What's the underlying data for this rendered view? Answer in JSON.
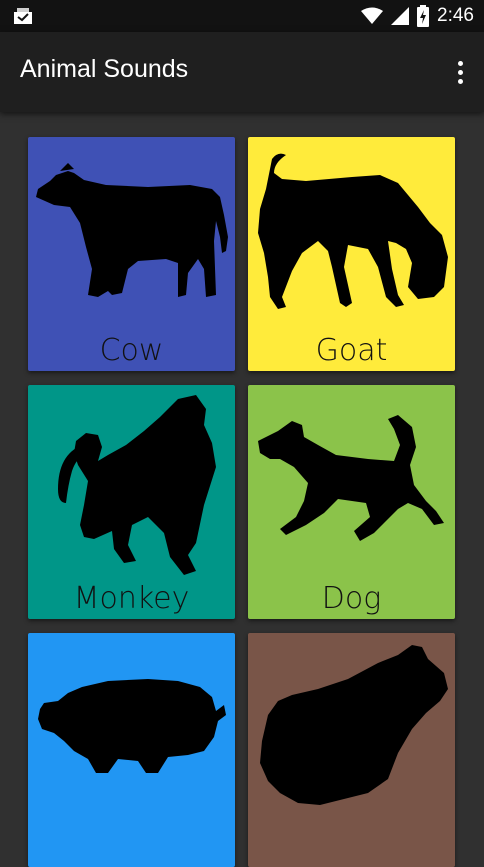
{
  "status_bar": {
    "time": "2:46",
    "icons": [
      "notification-icon",
      "wifi-icon",
      "signal-icon",
      "battery-charging-icon"
    ]
  },
  "app_bar": {
    "title": "Animal Sounds",
    "menu_icon": "overflow-menu-icon"
  },
  "animals": [
    {
      "name": "Cow",
      "color": "#3f51b5",
      "icon": "cow-silhouette-icon"
    },
    {
      "name": "Goat",
      "color": "#ffeb3b",
      "icon": "goat-silhouette-icon"
    },
    {
      "name": "Monkey",
      "color": "#009688",
      "icon": "monkey-silhouette-icon"
    },
    {
      "name": "Dog",
      "color": "#8bc34a",
      "icon": "dog-silhouette-icon"
    },
    {
      "name": "",
      "color": "#2196f3",
      "icon": "pig-silhouette-icon"
    },
    {
      "name": "",
      "color": "#795548",
      "icon": "frog-silhouette-icon"
    }
  ]
}
